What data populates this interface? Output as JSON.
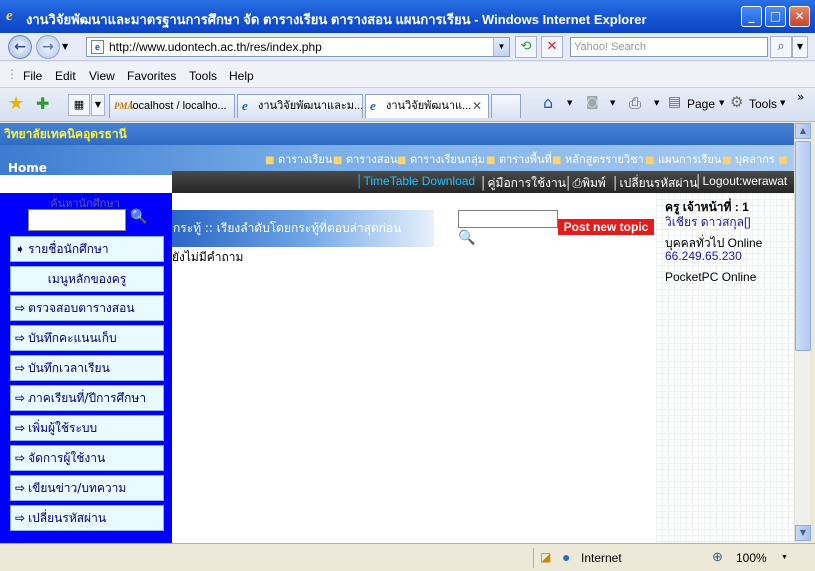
{
  "window": {
    "title": "งานวิจัยพัฒนาและมาตรฐานการศึกษา จัด ตารางเรียน ตารางสอน แผนการเรียน - Windows Internet Explorer",
    "min": "_",
    "max": "□",
    "close": "✕"
  },
  "address": {
    "url": "http://www.udontech.ac.th/res/index.php",
    "search_placeholder": "Yahoo! Search"
  },
  "menu": [
    "File",
    "Edit",
    "View",
    "Favorites",
    "Tools",
    "Help"
  ],
  "tabs": [
    {
      "label": "localhost / localho...",
      "icon": "phpmyadmin-icon"
    },
    {
      "label": "งานวิจัยพัฒนาและม...",
      "icon": "ie-icon"
    },
    {
      "label": "งานวิจัยพัฒนาแ...",
      "icon": "ie-icon"
    }
  ],
  "commands": {
    "page": "Page",
    "tools": "Tools"
  },
  "site": {
    "banner": "วิทยาลัยเทคนิคอุดรธานี",
    "home": "Home",
    "nav": [
      "ตารางเรียน",
      "ตารางสอน",
      "ตารางเรียนกลุ่ม",
      "ตารางพื้นที่",
      "หลักสูตรรายวิชา",
      "แผนการเรียน",
      "บุคลากร"
    ],
    "subnav": [
      "TimeTable Download",
      "คู่มือการใช้งาน",
      "พิมพ์",
      "เปลี่ยนรหัสผ่าน",
      "Logout:werawat"
    ],
    "left": {
      "search_label": "ค้นหานักศึกษา",
      "items": [
        {
          "label": "รายชื่อนักศึกษา",
          "arrow": "➧"
        },
        {
          "label": "เมนูหลักของครู",
          "arrow": ""
        },
        {
          "label": "ตรวจสอบตารางสอน",
          "arrow": "⇨"
        },
        {
          "label": "บันทึกคะแนนเก็บ",
          "arrow": "⇨"
        },
        {
          "label": "บันทึกเวลาเรียน",
          "arrow": "⇨"
        },
        {
          "label": "ภาคเรียนที่/ปีการศึกษา",
          "arrow": "⇨"
        },
        {
          "label": "เพิ่มผู้ใช้ระบบ",
          "arrow": "⇨"
        },
        {
          "label": "จัดการผู้ใช้งาน",
          "arrow": "⇨"
        },
        {
          "label": "เขียนข่าว/บทความ",
          "arrow": "⇨"
        },
        {
          "label": "เปลี่ยนรหัสผ่าน",
          "arrow": "⇨"
        }
      ]
    },
    "board": {
      "header": "กระทู้ :: เรียงลำดับโดยกระทู้ที่ตอบล่าสุดก่อน",
      "post_button": "Post new topic",
      "empty": "ยังไม่มีคำถาม"
    },
    "right": {
      "staff_label": "ครู เจ้าหน้าที่ : 1",
      "staff_name": "วิเชียร ดาวสกุล[]",
      "online_label": "บุคคลทั่วไป Online",
      "online_ip": "66.249.65.230",
      "pocket": "PocketPC Online"
    }
  },
  "status": {
    "zone": "Internet",
    "zoom": "100%"
  }
}
